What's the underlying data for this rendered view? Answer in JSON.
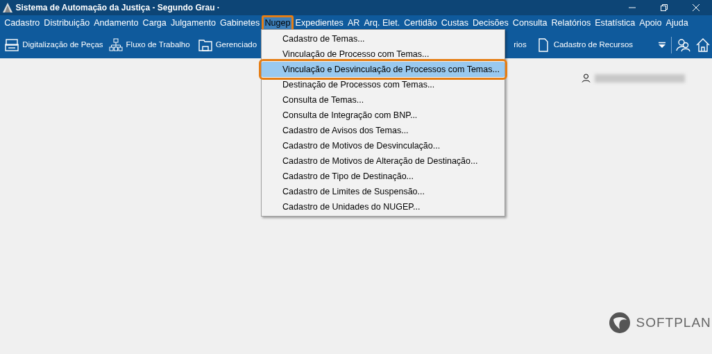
{
  "window": {
    "title": "Sistema de Automação da Justiça - Segundo Grau ·"
  },
  "menu_bar": [
    {
      "label": "Cadastro",
      "selected": false,
      "highlighted": false
    },
    {
      "label": "Distribuição",
      "selected": false,
      "highlighted": false
    },
    {
      "label": "Andamento",
      "selected": false,
      "highlighted": false
    },
    {
      "label": "Carga",
      "selected": false,
      "highlighted": false
    },
    {
      "label": "Julgamento",
      "selected": false,
      "highlighted": false
    },
    {
      "label": "Gabinetes",
      "selected": false,
      "highlighted": false
    },
    {
      "label": "Nugep",
      "selected": true,
      "highlighted": true
    },
    {
      "label": "Expedientes",
      "selected": false,
      "highlighted": false
    },
    {
      "label": "AR",
      "selected": false,
      "highlighted": false
    },
    {
      "label": "Arq. Elet.",
      "selected": false,
      "highlighted": false
    },
    {
      "label": "Certidão",
      "selected": false,
      "highlighted": false
    },
    {
      "label": "Custas",
      "selected": false,
      "highlighted": false
    },
    {
      "label": "Decisões",
      "selected": false,
      "highlighted": false
    },
    {
      "label": "Consulta",
      "selected": false,
      "highlighted": false
    },
    {
      "label": "Relatórios",
      "selected": false,
      "highlighted": false
    },
    {
      "label": "Estatística",
      "selected": false,
      "highlighted": false
    },
    {
      "label": "Apoio",
      "selected": false,
      "highlighted": false
    },
    {
      "label": "Ajuda",
      "selected": false,
      "highlighted": false
    }
  ],
  "toolbar": [
    {
      "label": "Digitalização de Peças",
      "kind": "scanner"
    },
    {
      "label": "Fluxo de Trabalho",
      "kind": "flow"
    },
    {
      "label": "Gerenciado",
      "kind": "folder"
    },
    {
      "label": "rios",
      "kind": "none"
    },
    {
      "label": "Cadastro de Recursos",
      "kind": "document"
    }
  ],
  "dropdown": [
    {
      "label": "Cadastro de Temas...",
      "selected": false,
      "highlighted": false
    },
    {
      "label": "Vinculação de Processo com Temas...",
      "selected": false,
      "highlighted": false
    },
    {
      "label": "Vinculação e Desvinculação de Processos com Temas...",
      "selected": true,
      "highlighted": true
    },
    {
      "label": "Destinação de Processos com Temas...",
      "selected": false,
      "highlighted": false
    },
    {
      "label": "Consulta de Temas...",
      "selected": false,
      "highlighted": false
    },
    {
      "label": "Consulta de Integração com BNP...",
      "selected": false,
      "highlighted": false
    },
    {
      "label": "Cadastro de Avisos dos Temas...",
      "selected": false,
      "highlighted": false
    },
    {
      "label": "Cadastro de Motivos de Desvinculação...",
      "selected": false,
      "highlighted": false
    },
    {
      "label": "Cadastro de Motivos de Alteração de Destinação...",
      "selected": false,
      "highlighted": false
    },
    {
      "label": "Cadastro de Tipo de Destinação...",
      "selected": false,
      "highlighted": false
    },
    {
      "label": "Cadastro de Limites de Suspensão...",
      "selected": false,
      "highlighted": false
    },
    {
      "label": "Cadastro de Unidades do NUGEP...",
      "selected": false,
      "highlighted": false
    }
  ],
  "logo": {
    "text": "SOFTPLAN"
  }
}
